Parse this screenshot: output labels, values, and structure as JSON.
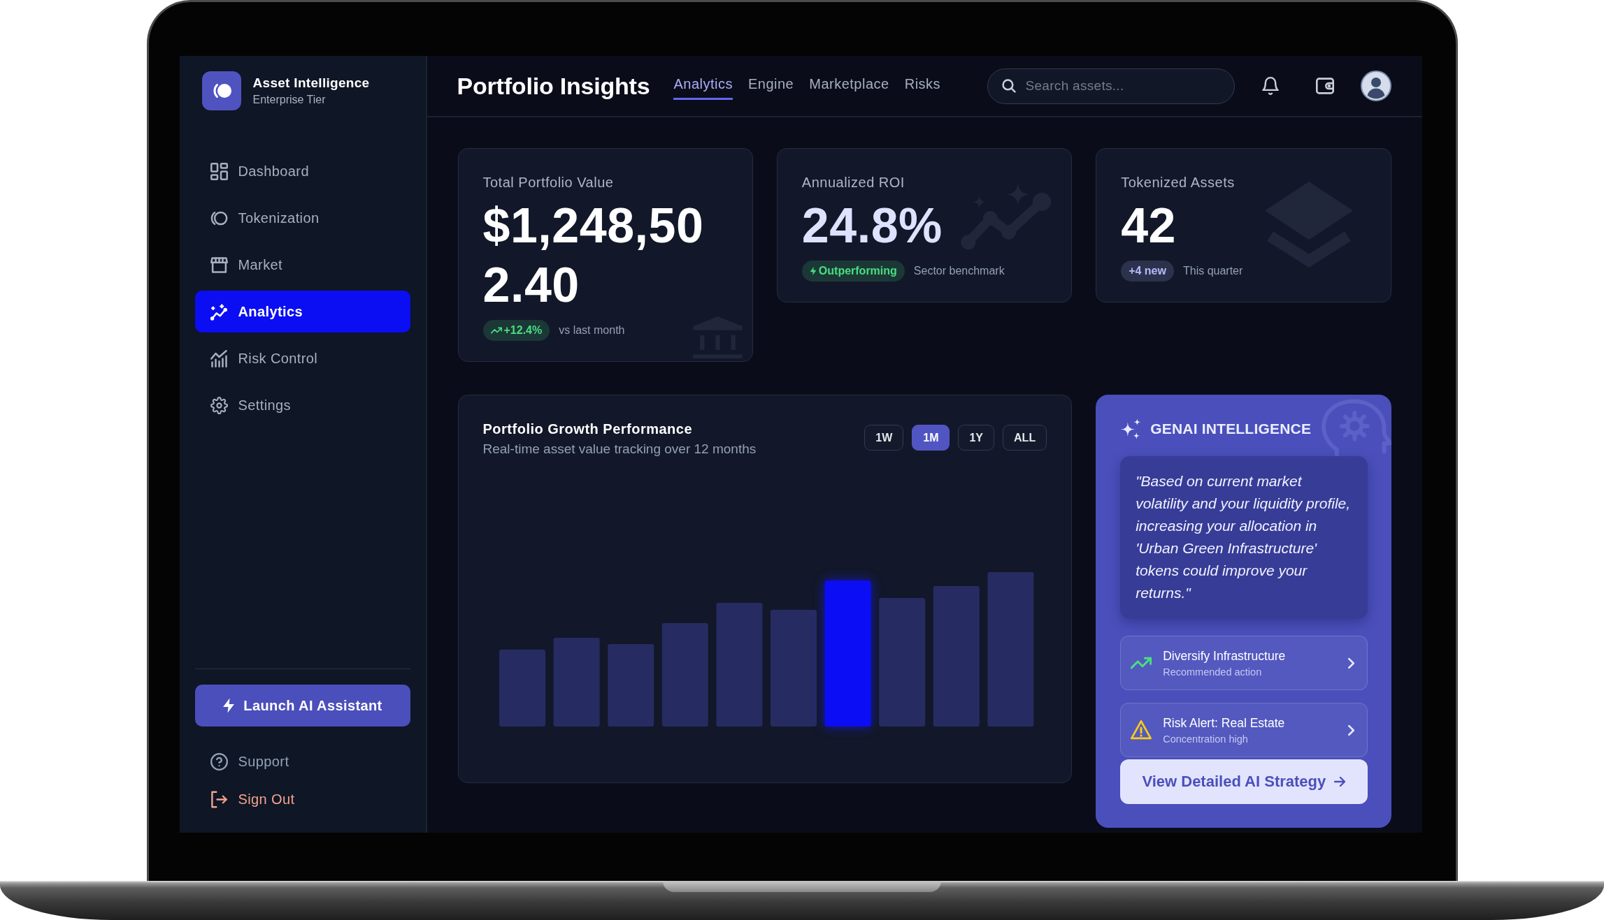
{
  "sidebar": {
    "brand": {
      "title": "Asset Intelligence",
      "subtitle": "Enterprise Tier"
    },
    "nav": [
      {
        "label": "Dashboard",
        "selected": false
      },
      {
        "label": "Tokenization",
        "selected": false
      },
      {
        "label": "Market",
        "selected": false
      },
      {
        "label": "Analytics",
        "selected": true
      },
      {
        "label": "Risk Control",
        "selected": false
      },
      {
        "label": "Settings",
        "selected": false
      }
    ],
    "launch_button": {
      "label": "Launch AI Assistant"
    },
    "footer_links": [
      {
        "label": "Support",
        "color": "#94a3b8"
      },
      {
        "label": "Sign Out",
        "color": "#f2a48f"
      }
    ]
  },
  "header": {
    "title": "Portfolio Insights",
    "tabs": [
      {
        "label": "Analytics",
        "selected": true
      },
      {
        "label": "Engine",
        "selected": false
      },
      {
        "label": "Marketplace",
        "selected": false
      },
      {
        "label": "Risks",
        "selected": false
      }
    ],
    "search": {
      "placeholder": "Search assets..."
    }
  },
  "stats": [
    {
      "kind": "portfolio",
      "label": "Total Portfolio Value",
      "value": "$1,248,502.40",
      "badge": {
        "text": "+12.4%",
        "color": "#4ade80"
      },
      "note": "vs last month"
    },
    {
      "kind": "roi",
      "label": "Annualized ROI",
      "value": "24.8%",
      "badge": {
        "text": "Outperforming",
        "color": "#4ade80"
      },
      "note": "Sector benchmark"
    },
    {
      "kind": "tokens",
      "label": "Tokenized Assets",
      "value": "42",
      "badge": {
        "text": "+4 new",
        "color": "#b4bcfd"
      },
      "note": "This quarter"
    }
  ],
  "growth_chart": {
    "title": "Portfolio Growth Performance",
    "subtitle": "Real-time asset value tracking over 12 months",
    "ranges": [
      {
        "label": "1W",
        "selected": false
      },
      {
        "label": "1M",
        "selected": true
      },
      {
        "label": "1Y",
        "selected": false
      },
      {
        "label": "ALL",
        "selected": false
      }
    ],
    "bars": [
      {
        "highlighted": false
      },
      {
        "highlighted": false
      },
      {
        "highlighted": false
      },
      {
        "highlighted": false
      },
      {
        "highlighted": false
      },
      {
        "highlighted": false
      },
      {
        "highlighted": true
      },
      {
        "highlighted": false
      },
      {
        "highlighted": false
      },
      {
        "highlighted": false
      }
    ]
  },
  "ai_panel": {
    "title": "GENAI INTELLIGENCE",
    "quote": "\"Based on current market volatility and your liquidity profile, increasing your allocation in 'Urban Green Infrastructure' tokens could improve your returns.\"",
    "actions": [
      {
        "kind": "recommendation",
        "title": "Diversify Infrastructure",
        "subtitle": "Recommended action"
      },
      {
        "kind": "alert",
        "title": "Risk Alert: Real Estate",
        "subtitle": "Concentration high"
      }
    ],
    "button": {
      "label": "View Detailed AI Strategy"
    }
  }
}
